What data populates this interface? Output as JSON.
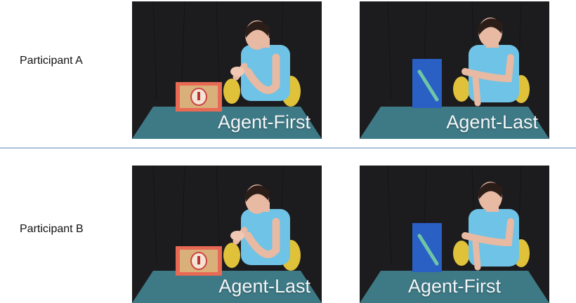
{
  "rows": [
    {
      "participant": "Participant A",
      "left_caption": "Agent-First",
      "right_caption": "Agent-Last"
    },
    {
      "participant": "Participant B",
      "left_caption": "Agent-Last",
      "right_caption": "Agent-First"
    }
  ],
  "colors": {
    "divider": "#a9bedb",
    "curtain": "#1c1b1e",
    "table": "#3d7a86",
    "shirt": "#6ec3e6",
    "chair": "#e0c23a",
    "red_box": "#e86a55",
    "blue_box": "#2a5fc4"
  }
}
